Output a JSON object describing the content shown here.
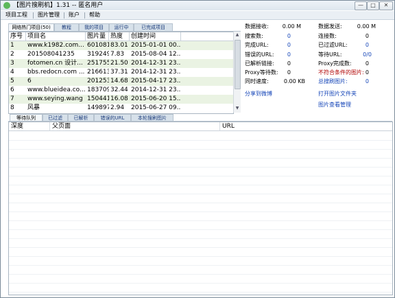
{
  "window": {
    "title": "【图片搜刷机】1.31 -- 匿名用户",
    "controls": {
      "minimize": "—",
      "restore": "□",
      "close": "✕"
    }
  },
  "menubar": [
    "项目工程",
    "图片管理",
    "账户",
    "帮助"
  ],
  "top_tabs": [
    "网络热门项目(50)",
    "教程",
    "我的项目",
    "运行中",
    "已完成项目"
  ],
  "grid": {
    "columns": [
      "序号",
      "项目名",
      "图片量",
      "热度",
      "创建时间"
    ],
    "rows": [
      [
        "1",
        "www.k1982.com...",
        "601081",
        "83.01",
        "2015-01-01 00..."
      ],
      [
        "2",
        "201508041235",
        "319249",
        "7.83",
        "2015-08-04 12..."
      ],
      [
        "3",
        "fotomen.cn 设计...",
        "251755",
        "21.50",
        "2014-12-31 23..."
      ],
      [
        "4",
        "bbs.redocn.com ...",
        "216613",
        "37.31",
        "2014-12-31 23..."
      ],
      [
        "5",
        "6",
        "201253",
        "14.68",
        "2015-04-17 23..."
      ],
      [
        "6",
        "www.blueidea.co...",
        "183709",
        "32.44",
        "2014-12-31 23..."
      ],
      [
        "7",
        "www.seying.wang",
        "150441",
        "16.08",
        "2015-06-20 15..."
      ],
      [
        "8",
        "风暴",
        "149897",
        "2.94",
        "2015-06-27 09..."
      ]
    ]
  },
  "stats_left": [
    {
      "label": "数据接收:",
      "value": "0.00 M",
      "color": "#000000"
    },
    {
      "label": "搜索数:",
      "value": "0",
      "color": "#000000"
    },
    {
      "label": "完成URL:",
      "value": "0",
      "color": "#000000"
    },
    {
      "label": "错误的URL:",
      "value": "0",
      "color": "#000000"
    },
    {
      "label": "已解析链接:",
      "value": "0",
      "color": "#000000"
    },
    {
      "label": "Proxy等待数:",
      "value": "0",
      "color": "#000000"
    },
    {
      "label": "同时速度:",
      "value": "0.00 KB",
      "color": "#000000"
    }
  ],
  "stats_right": [
    {
      "label": "数据发送:",
      "value": "0.00 M",
      "color": "#000000"
    },
    {
      "label": "连接数:",
      "value": "0",
      "color": "#000000"
    },
    {
      "label": "已过滤URL:",
      "value": "0",
      "color": "#000000"
    },
    {
      "label": "等待URL:",
      "value": "0/0",
      "color": "#000000"
    },
    {
      "label": "Proxy完成数:",
      "value": "0",
      "color": "#000000"
    },
    {
      "label": "不符合条件的图片:",
      "value": "0",
      "color": "#b00000"
    },
    {
      "label": "总搜刷图片:",
      "value": "0",
      "color": "#1646b8"
    }
  ],
  "links": {
    "share": "分享到微博",
    "open_folder": "打开图片文件夹",
    "image_manager": "图片查看管理"
  },
  "bottom_tabs": [
    "等待队列",
    "已过滤",
    "已解析",
    "错误的URL",
    "本轮搜刷图片"
  ],
  "lower_grid": {
    "columns": [
      "深度",
      "父页面",
      "URL"
    ]
  }
}
